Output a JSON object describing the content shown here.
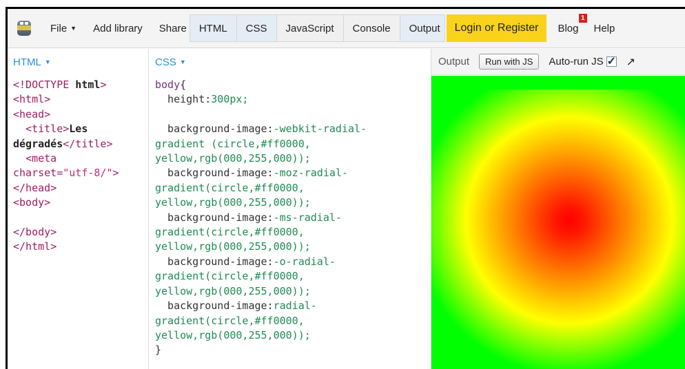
{
  "toolbar": {
    "file": "File",
    "add_library": "Add library",
    "share": "Share",
    "tabs": [
      "HTML",
      "CSS",
      "JavaScript",
      "Console",
      "Output"
    ],
    "login": "Login or Register",
    "blog": "Blog",
    "blog_badge": "1",
    "help": "Help"
  },
  "html_pane": {
    "title": "HTML",
    "lines": [
      "<!DOCTYPE html>",
      "<html>",
      "<head>",
      "  <title>Les",
      "dégradés</title>",
      "  <meta",
      "charset=\"utf-8/\">",
      "</head>",
      "<body>",
      "",
      "</body>",
      "</html>"
    ]
  },
  "css_pane": {
    "title": "CSS",
    "lines": [
      "body{",
      "  height:300px;",
      "",
      "  background-image:-webkit-radial-",
      "gradient (circle,#ff0000,",
      "yellow,rgb(000,255,000));",
      "  background-image:-moz-radial-",
      "gradient(circle,#ff0000,",
      "yellow,rgb(000,255,000));",
      "  background-image:-ms-radial-",
      "gradient(circle,#ff0000,",
      "yellow,rgb(000,255,000));",
      "  background-image:-o-radial-",
      "gradient(circle,#ff0000,",
      "yellow,rgb(000,255,000));",
      "  background-image:radial-",
      "gradient(circle,#ff0000,",
      "yellow,rgb(000,255,000));",
      "}"
    ]
  },
  "output_pane": {
    "title": "Output",
    "run_button": "Run with JS",
    "autorun_label": "Auto-run JS",
    "autorun_checked": true,
    "gradient_colors": [
      "#ff0000",
      "#ffff00",
      "#00ff00"
    ]
  },
  "colors": {
    "login_bg": "#f9d21b",
    "pane_title": "#2a8fd6",
    "tag": "#a01d60",
    "css_value": "#208b53"
  }
}
